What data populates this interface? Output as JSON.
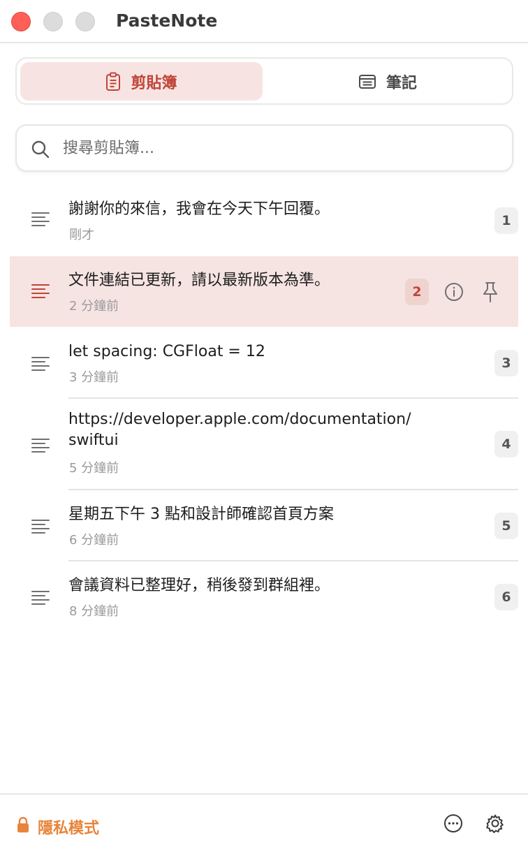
{
  "app": {
    "title": "PasteNote"
  },
  "tabs": [
    {
      "label": "剪貼簿",
      "icon": "clipboard-icon",
      "active": true
    },
    {
      "label": "筆記",
      "icon": "note-icon",
      "active": false
    }
  ],
  "search": {
    "placeholder": "搜尋剪貼簿...",
    "value": ""
  },
  "items": [
    {
      "text": "謝謝你的來信，我會在今天下午回覆。",
      "time": "剛才",
      "index": "1",
      "selected": false
    },
    {
      "text": "文件連結已更新，請以最新版本為準。",
      "time": "2 分鐘前",
      "index": "2",
      "selected": true
    },
    {
      "text": "let spacing: CGFloat = 12",
      "time": "3 分鐘前",
      "index": "3",
      "selected": false
    },
    {
      "text_line1": "https://developer.apple.com/documentation/",
      "text_line2": "swiftui",
      "time": "5 分鐘前",
      "index": "4",
      "selected": false
    },
    {
      "text": "星期五下午 3 點和設計師確認首頁方案",
      "time": "6 分鐘前",
      "index": "5",
      "selected": false
    },
    {
      "text": "會議資料已整理好，稍後發到群組裡。",
      "time": "8 分鐘前",
      "index": "6",
      "selected": false
    }
  ],
  "footer": {
    "privacy_label": "隱私模式",
    "more_icon": "ellipsis-circle-icon",
    "settings_icon": "gear-icon"
  },
  "colors": {
    "accent": "#c0453a",
    "selected_bg": "#f6e4e2",
    "privacy": "#e8843a"
  }
}
